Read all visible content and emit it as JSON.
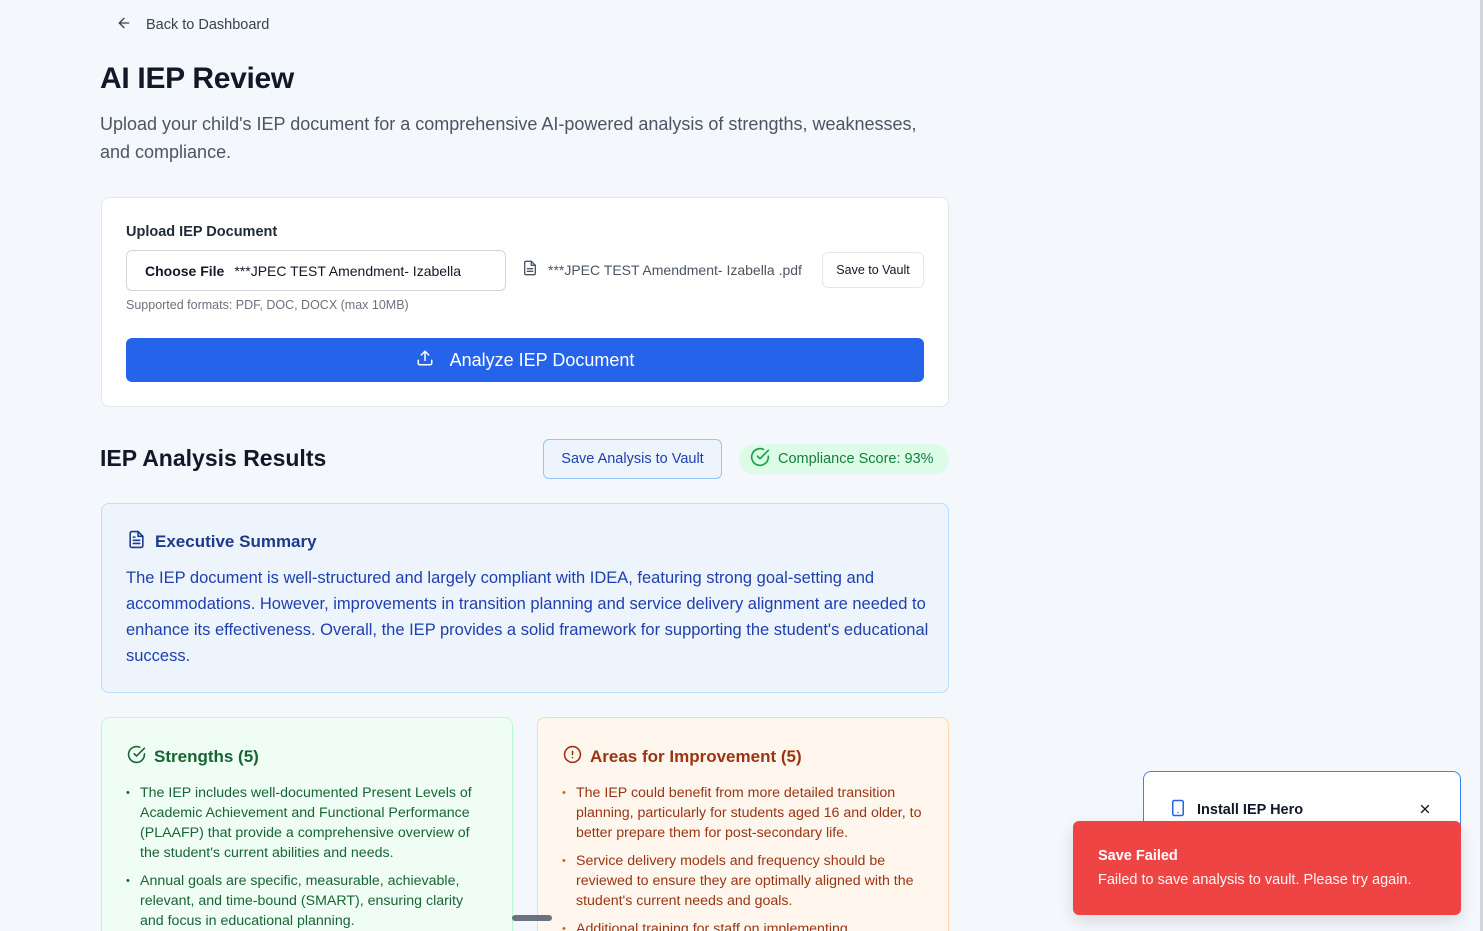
{
  "nav": {
    "back_label": "Back to Dashboard"
  },
  "header": {
    "title": "AI IEP Review",
    "subtitle": "Upload your child's IEP document for a comprehensive AI-powered analysis of strengths, weaknesses, and compliance."
  },
  "upload": {
    "label": "Upload IEP Document",
    "choose_file_label": "Choose File",
    "selected_file_input": "***JPEC TEST Amendment- Izabella",
    "selected_file_name": "***JPEC TEST Amendment- Izabella .pdf",
    "save_to_vault_label": "Save to Vault",
    "supported_formats": "Supported formats: PDF, DOC, DOCX (max 10MB)",
    "analyze_label": "Analyze IEP Document"
  },
  "results": {
    "title": "IEP Analysis Results",
    "save_analysis_label": "Save Analysis to Vault",
    "compliance_score_label": "Compliance Score: 93%",
    "compliance_score": 93
  },
  "summary": {
    "title": "Executive Summary",
    "text": "The IEP document is well-structured and largely compliant with IDEA, featuring strong goal-setting and accommodations. However, improvements in transition planning and service delivery alignment are needed to enhance its effectiveness. Overall, the IEP provides a solid framework for supporting the student's educational success."
  },
  "strengths": {
    "title": "Strengths (5)",
    "items": [
      "The IEP includes well-documented Present Levels of Academic Achievement and Functional Performance (PLAAFP) that provide a comprehensive overview of the student's current abilities and needs.",
      "Annual goals are specific, measurable, achievable, relevant, and time-bound (SMART), ensuring clarity and focus in educational planning."
    ]
  },
  "improvements": {
    "title": "Areas for Improvement (5)",
    "items": [
      "The IEP could benefit from more detailed transition planning, particularly for students aged 16 and older, to better prepare them for post-secondary life.",
      "Service delivery models and frequency should be reviewed to ensure they are optimally aligned with the student's current needs and goals.",
      "Additional training for staff on implementing"
    ]
  },
  "install_prompt": {
    "title": "Install IEP Hero"
  },
  "toast": {
    "title": "Save Failed",
    "message": "Failed to save analysis to vault. Please try again."
  },
  "colors": {
    "primary": "#2563eb",
    "success": "#15803d",
    "warning": "#9a3412",
    "error": "#ef4444",
    "summary_text": "#1e40af"
  },
  "icons": {
    "back": "arrow-left-icon",
    "file": "file-icon",
    "upload": "upload-icon",
    "compliance": "check-circle-icon",
    "summary": "file-text-icon",
    "strengths": "check-circle-icon",
    "improvements": "alert-circle-icon",
    "install": "smartphone-icon",
    "close": "close-icon"
  }
}
